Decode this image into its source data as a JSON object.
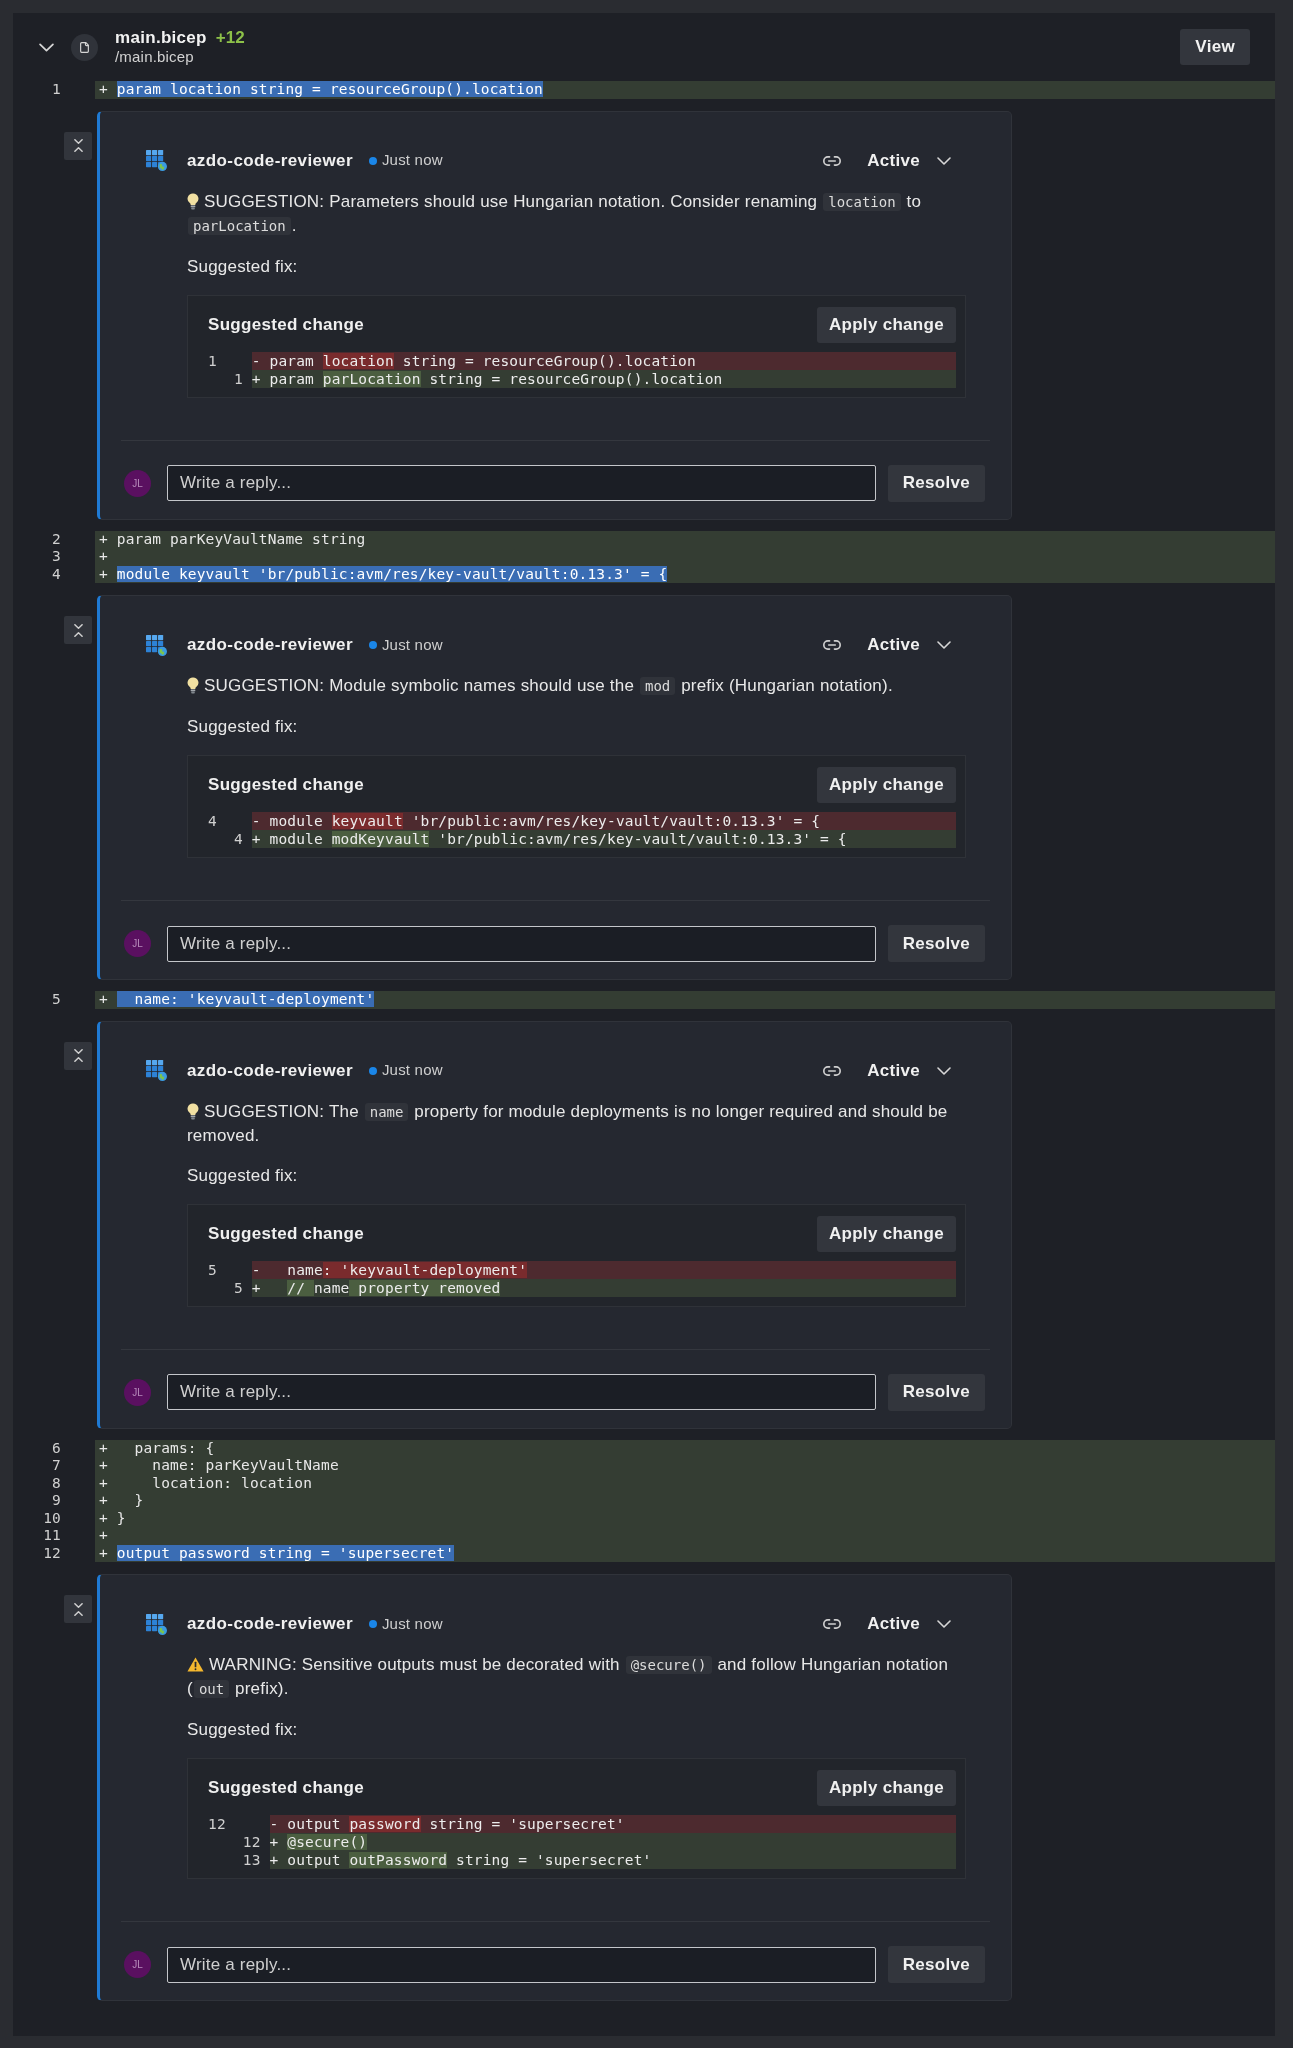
{
  "file": {
    "expanded": true,
    "name": "main.bicep",
    "additions": "+12",
    "path": "/main.bicep",
    "view_button": "View"
  },
  "lines": [
    {
      "number": "1",
      "kind": "added",
      "sign": "+",
      "code": "param location string = resourceGroup().location",
      "highlighted": true,
      "thread": {
        "author": "azdo-code-reviewer",
        "time": "Just now",
        "status": "Active",
        "kind": "suggestion",
        "message": [
          {
            "text": "SUGGESTION: Parameters should use Hungarian notation. Consider renaming "
          },
          {
            "code": "location"
          },
          {
            "text": " to "
          },
          {
            "code": "parLocation"
          },
          {
            "text": "."
          }
        ],
        "fix_label": "Suggested fix:",
        "suggestion": {
          "title": "Suggested change",
          "apply_button": "Apply change",
          "lines": [
            {
              "kind": "removed",
              "old_number": "1",
              "sign": "-",
              "segments": [
                {
                  "text": "param ",
                  "changed": false
                },
                {
                  "text": "location",
                  "changed": true
                },
                {
                  "text": " string = resourceGroup().location",
                  "changed": false
                }
              ]
            },
            {
              "kind": "added",
              "new_number": "1",
              "sign": "+",
              "segments": [
                {
                  "text": "param ",
                  "changed": false
                },
                {
                  "text": "parLocation",
                  "changed": true
                },
                {
                  "text": " string = resourceGroup().location",
                  "changed": false
                }
              ]
            }
          ]
        },
        "reply": {
          "avatar": "JL",
          "placeholder": "Write a reply...",
          "resolve_button": "Resolve"
        }
      }
    },
    {
      "number": "2",
      "kind": "added",
      "sign": "+",
      "code": "param parKeyVaultName string",
      "highlighted": false
    },
    {
      "number": "3",
      "kind": "added",
      "sign": "+"
    },
    {
      "number": "4",
      "kind": "added",
      "sign": "+",
      "code": "module keyvault 'br/public:avm/res/key-vault/vault:0.13.3' = {",
      "highlighted": true,
      "thread": {
        "author": "azdo-code-reviewer",
        "time": "Just now",
        "status": "Active",
        "kind": "suggestion",
        "message": [
          {
            "text": "SUGGESTION: Module symbolic names should use the "
          },
          {
            "code": "mod"
          },
          {
            "text": " prefix (Hungarian notation)."
          }
        ],
        "fix_label": "Suggested fix:",
        "suggestion": {
          "title": "Suggested change",
          "apply_button": "Apply change",
          "lines": [
            {
              "kind": "removed",
              "old_number": "4",
              "sign": "-",
              "segments": [
                {
                  "text": "module ",
                  "changed": false
                },
                {
                  "text": "keyvault",
                  "changed": true
                },
                {
                  "text": " 'br/public:avm/res/key-vault/vault:0.13.3' = {",
                  "changed": false
                }
              ]
            },
            {
              "kind": "added",
              "new_number": "4",
              "sign": "+",
              "segments": [
                {
                  "text": "module ",
                  "changed": false
                },
                {
                  "text": "modKeyvault",
                  "changed": true
                },
                {
                  "text": " 'br/public:avm/res/key-vault/vault:0.13.3' = {",
                  "changed": false
                }
              ]
            }
          ]
        },
        "reply": {
          "avatar": "JL",
          "placeholder": "Write a reply...",
          "resolve_button": "Resolve"
        }
      }
    },
    {
      "number": "5",
      "kind": "added",
      "sign": "+",
      "code": "  name: 'keyvault-deployment'",
      "highlighted": true,
      "thread": {
        "author": "azdo-code-reviewer",
        "time": "Just now",
        "status": "Active",
        "kind": "suggestion",
        "message": [
          {
            "text": "SUGGESTION: The "
          },
          {
            "code": "name"
          },
          {
            "text": " property for module deployments is no longer required and should be removed."
          }
        ],
        "fix_label": "Suggested fix:",
        "suggestion": {
          "title": "Suggested change",
          "apply_button": "Apply change",
          "lines": [
            {
              "kind": "removed",
              "old_number": "5",
              "sign": "-",
              "segments": [
                {
                  "text": "  name",
                  "changed": false
                },
                {
                  "text": ": 'keyvault-deployment'",
                  "changed": true
                }
              ]
            },
            {
              "kind": "added",
              "new_number": "5",
              "sign": "+",
              "segments": [
                {
                  "text": "  // ",
                  "changed": true
                },
                {
                  "text": "name",
                  "changed": false
                },
                {
                  "text": " property removed",
                  "changed": true
                }
              ]
            }
          ]
        },
        "reply": {
          "avatar": "JL",
          "placeholder": "Write a reply...",
          "resolve_button": "Resolve"
        }
      }
    },
    {
      "number": "6",
      "kind": "added",
      "sign": "+",
      "code": "  params: {",
      "highlighted": false
    },
    {
      "number": "7",
      "kind": "added",
      "sign": "+",
      "code": "    name: parKeyVaultName",
      "highlighted": false
    },
    {
      "number": "8",
      "kind": "added",
      "sign": "+",
      "code": "    location: location",
      "highlighted": false
    },
    {
      "number": "9",
      "kind": "added",
      "sign": "+",
      "code": "  }",
      "highlighted": false
    },
    {
      "number": "10",
      "kind": "added",
      "sign": "+",
      "code": "}",
      "highlighted": false
    },
    {
      "number": "11",
      "kind": "added",
      "sign": "+"
    },
    {
      "number": "12",
      "kind": "added",
      "sign": "+",
      "code": "output password string = 'supersecret'",
      "highlighted": true,
      "thread": {
        "author": "azdo-code-reviewer",
        "time": "Just now",
        "status": "Active",
        "kind": "warning",
        "message": [
          {
            "text": "WARNING: Sensitive outputs must be decorated with "
          },
          {
            "code": "@secure()"
          },
          {
            "text": " and follow Hungarian notation ("
          },
          {
            "code": "out"
          },
          {
            "text": " prefix)."
          }
        ],
        "fix_label": "Suggested fix:",
        "suggestion": {
          "title": "Suggested change",
          "apply_button": "Apply change",
          "lines": [
            {
              "kind": "removed",
              "old_number": "12",
              "sign": "-",
              "segments": [
                {
                  "text": "output ",
                  "changed": false
                },
                {
                  "text": "password",
                  "changed": true
                },
                {
                  "text": " string = 'supersecret'",
                  "changed": false
                }
              ]
            },
            {
              "kind": "added",
              "new_number": "12",
              "sign": "+",
              "segments": [
                {
                  "text": "@secure()",
                  "changed": true
                }
              ]
            },
            {
              "kind": "added",
              "new_number": "13",
              "sign": "+",
              "segments": [
                {
                  "text": "output ",
                  "changed": false
                },
                {
                  "text": "outPassword",
                  "changed": true
                },
                {
                  "text": " string = 'supersecret'",
                  "changed": false
                }
              ]
            }
          ]
        },
        "reply": {
          "avatar": "JL",
          "placeholder": "Write a reply...",
          "resolve_button": "Resolve"
        }
      }
    }
  ]
}
